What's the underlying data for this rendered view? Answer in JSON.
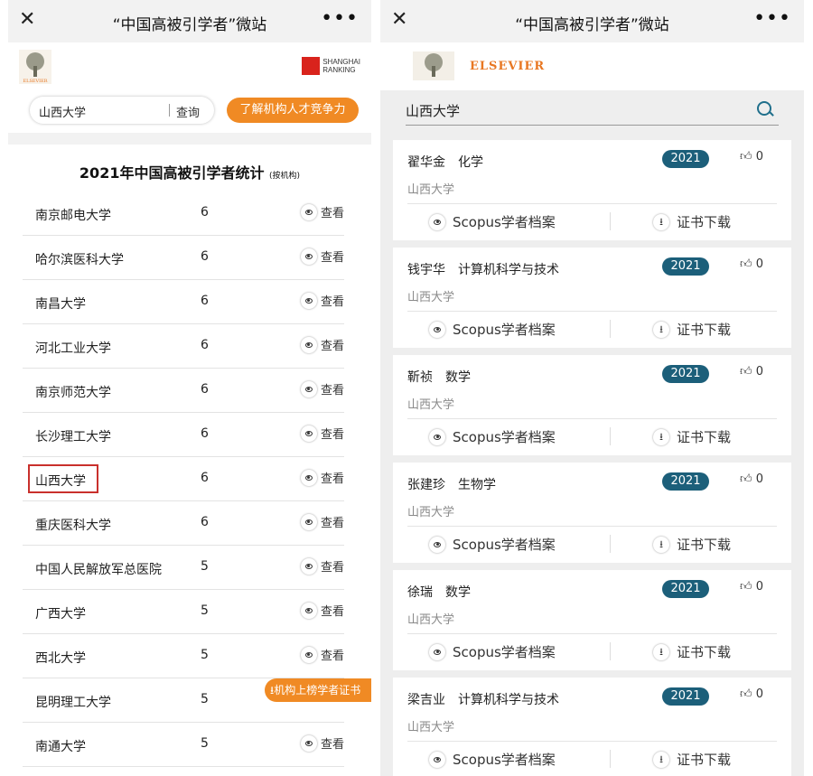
{
  "left": {
    "topbar": {
      "close": "✕",
      "title": "“中国高被引学者”微站",
      "more": "•••"
    },
    "logos": {
      "elsevier_small": "ELSEVIER",
      "sr_line1": "SHANGHAI",
      "sr_line2": "RANKING"
    },
    "search": {
      "value": "山西大学",
      "button": "查询"
    },
    "orange_button": "了解机构人才竞争力",
    "stat_title": "2021年中国高被引学者统计",
    "stat_subtitle": "(按机构)",
    "view_label": "查看",
    "rows": [
      {
        "name": "南京邮电大学",
        "count": "6"
      },
      {
        "name": "哈尔滨医科大学",
        "count": "6"
      },
      {
        "name": "南昌大学",
        "count": "6"
      },
      {
        "name": "河北工业大学",
        "count": "6"
      },
      {
        "name": "南京师范大学",
        "count": "6"
      },
      {
        "name": "长沙理工大学",
        "count": "6"
      },
      {
        "name": "山西大学",
        "count": "6"
      },
      {
        "name": "重庆医科大学",
        "count": "6"
      },
      {
        "name": "中国人民解放军总医院",
        "count": "5"
      },
      {
        "name": "广西大学",
        "count": "5"
      },
      {
        "name": "西北大学",
        "count": "5"
      },
      {
        "name": "昆明理工大学",
        "count": "5"
      },
      {
        "name": "南通大学",
        "count": "5"
      }
    ],
    "float_button": "⭳机构上榜学者证书"
  },
  "right": {
    "topbar": {
      "close": "✕",
      "title": "“中国高被引学者”微站",
      "more": "•••"
    },
    "brand": "ELSEVIER",
    "search_value": "山西大学",
    "scopus_label": "Scopus学者档案",
    "download_label": "证书下载",
    "cards": [
      {
        "name": "翟华金",
        "field": "化学",
        "inst": "山西大学",
        "year": "2021",
        "likes": "0"
      },
      {
        "name": "钱宇华",
        "field": "计算机科学与技术",
        "inst": "山西大学",
        "year": "2021",
        "likes": "0"
      },
      {
        "name": "靳祯",
        "field": "数学",
        "inst": "山西大学",
        "year": "2021",
        "likes": "0"
      },
      {
        "name": "张建珍",
        "field": "生物学",
        "inst": "山西大学",
        "year": "2021",
        "likes": "0"
      },
      {
        "name": "徐瑞",
        "field": "数学",
        "inst": "山西大学",
        "year": "2021",
        "likes": "0"
      },
      {
        "name": "梁吉业",
        "field": "计算机科学与技术",
        "inst": "山西大学",
        "year": "2021",
        "likes": "0"
      }
    ]
  },
  "colors": {
    "orange": "#f08a24",
    "year_badge": "#1c5f7a",
    "highlight": "#c9302c",
    "elsevier": "#e87722"
  }
}
